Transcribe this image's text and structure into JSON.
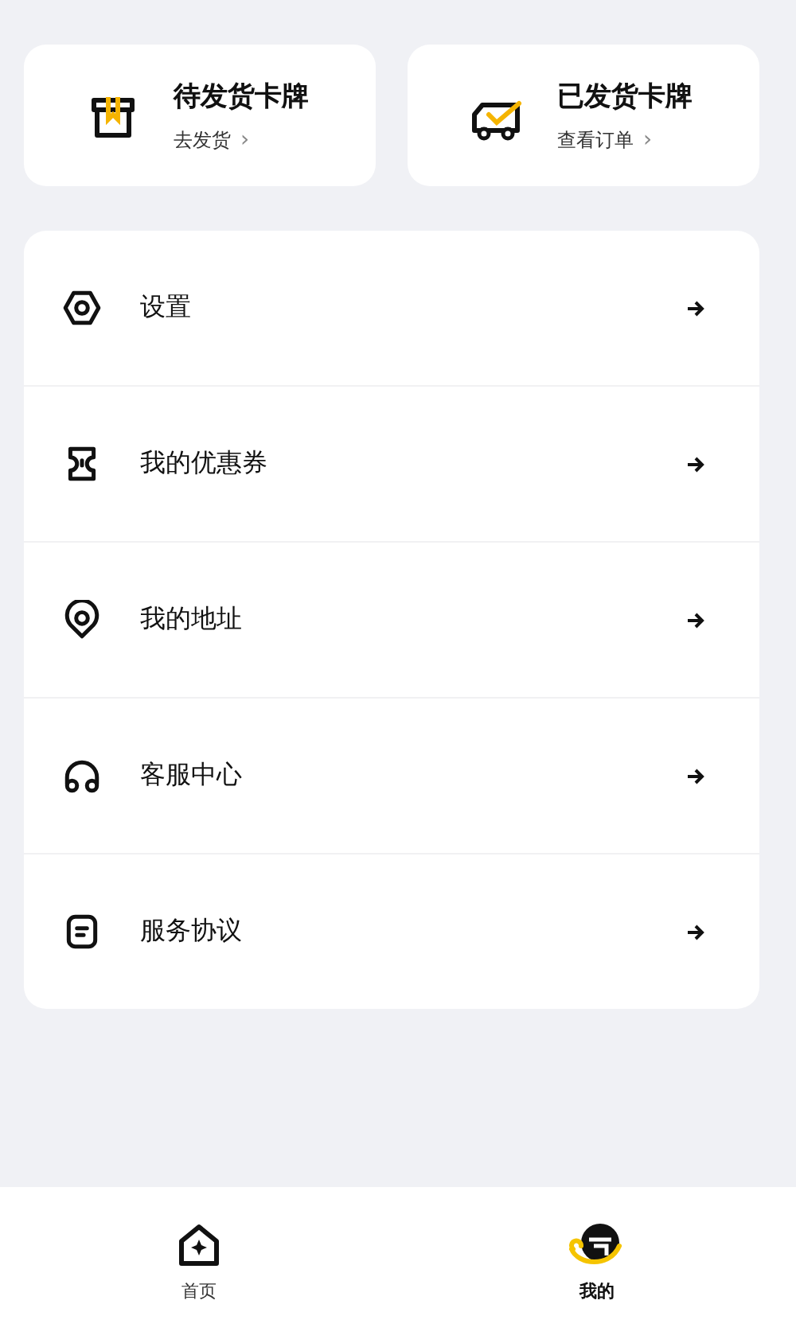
{
  "order_cards": [
    {
      "kind": "box",
      "title": "待发货卡牌",
      "link": "去发货",
      "chevron": "›"
    },
    {
      "kind": "truck",
      "title": "已发货卡牌",
      "link": "查看订单",
      "chevron": "›"
    }
  ],
  "menu": [
    {
      "kind": "settings",
      "label": "设置"
    },
    {
      "kind": "coupon",
      "label": "我的优惠券"
    },
    {
      "kind": "location",
      "label": "我的地址"
    },
    {
      "kind": "headset",
      "label": "客服中心"
    },
    {
      "kind": "document",
      "label": "服务协议"
    }
  ],
  "tabs": [
    {
      "kind": "home",
      "label": "首页",
      "selected": false
    },
    {
      "kind": "profile",
      "label": "我的",
      "selected": true
    }
  ]
}
